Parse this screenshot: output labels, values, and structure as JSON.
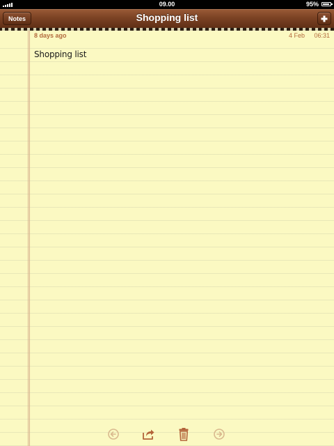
{
  "status_bar": {
    "time": "09.00",
    "battery": "95%"
  },
  "header": {
    "title": "Shopping list",
    "notes_button_label": "Notes",
    "add_icon": "plus-icon"
  },
  "note": {
    "age": "8 days ago",
    "date": "4 Feb",
    "time": "06:31",
    "body": "Shopping list"
  },
  "toolbar": {
    "icons": [
      "back-arrow-icon",
      "share-icon",
      "trash-icon",
      "forward-arrow-icon"
    ]
  },
  "colors": {
    "paper": "#fbf9c2",
    "leather": "#7c4324",
    "meta_text": "#b36a3d",
    "toolbar_icon_active": "#b3643a",
    "toolbar_icon_disabled": "#d9b98e"
  }
}
